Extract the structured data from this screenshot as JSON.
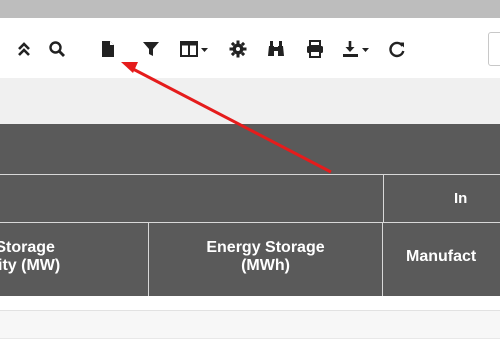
{
  "toolbar": {
    "icons": [
      "collapse-icon",
      "search-icon",
      "document-icon",
      "filter-icon",
      "columns-icon",
      "settings-icon",
      "find-icon",
      "print-icon",
      "download-icon",
      "refresh-icon"
    ]
  },
  "table": {
    "group_headers": [
      "",
      "In"
    ],
    "column_headers": [
      [
        "y Storage",
        "ity (MW)"
      ],
      [
        "Energy Storage",
        "(MWh)"
      ],
      [
        "Manufact"
      ]
    ]
  },
  "annotation": {
    "arrow_color": "#e51c1c"
  },
  "colors": {
    "header_bg": "#5a5a5a",
    "topbar": "#bdbdbd",
    "band": "#f0f0f0"
  }
}
